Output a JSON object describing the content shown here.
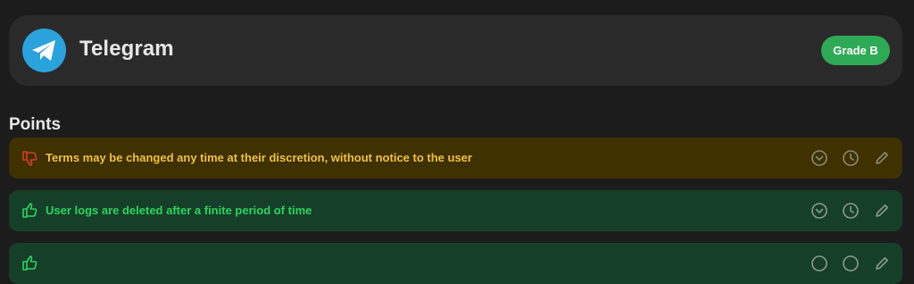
{
  "app": {
    "name": "Telegram",
    "logo_icon": "telegram-paper-plane-icon",
    "logo_color": "#2aa3dc",
    "grade": "Grade B",
    "grade_color": "#2eaa57"
  },
  "points_section": {
    "title": "Points",
    "items": [
      {
        "sentiment": "negative",
        "icon": "thumbs-down-icon",
        "text": "Terms may be changed any time at their discretion, without notice to the user",
        "background": "#3f3100",
        "text_color": "#f1c040"
      },
      {
        "sentiment": "positive",
        "icon": "thumbs-up-icon",
        "text": "User logs are deleted after a finite period of time",
        "background": "#163f29",
        "text_color": "#2bd45f"
      },
      {
        "sentiment": "positive",
        "icon": "thumbs-up-icon",
        "text": "",
        "background": "#163f29",
        "text_color": "#2bd45f"
      }
    ],
    "actions": [
      "expand-icon",
      "history-icon",
      "edit-icon"
    ]
  }
}
